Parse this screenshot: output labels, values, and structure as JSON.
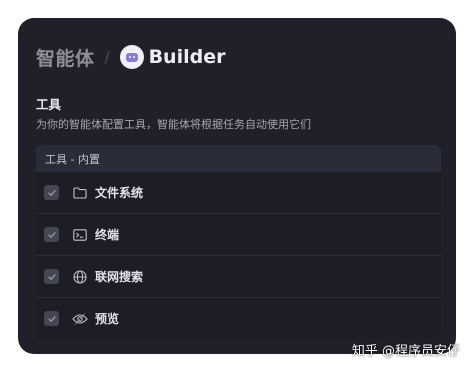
{
  "breadcrumb": {
    "root": "智能体",
    "separator": "/",
    "current": "Builder"
  },
  "tools_section": {
    "title": "工具",
    "description": "为你的智能体配置工具，智能体将根据任务自动使用它们",
    "group_header": "工具 - 内置",
    "items": [
      {
        "label": "文件系统",
        "icon": "folder-icon",
        "checked": true
      },
      {
        "label": "终端",
        "icon": "terminal-icon",
        "checked": true
      },
      {
        "label": "联网搜索",
        "icon": "globe-icon",
        "checked": true
      },
      {
        "label": "预览",
        "icon": "eye-icon",
        "checked": true
      }
    ]
  },
  "watermark": "知乎 @程序员安仔",
  "colors": {
    "panel_bg": "#1f2029",
    "header_bg": "#2b2c3a",
    "checkbox_bg": "#444654",
    "text_primary": "#e2e3ea",
    "text_muted": "#a4a6b2"
  }
}
